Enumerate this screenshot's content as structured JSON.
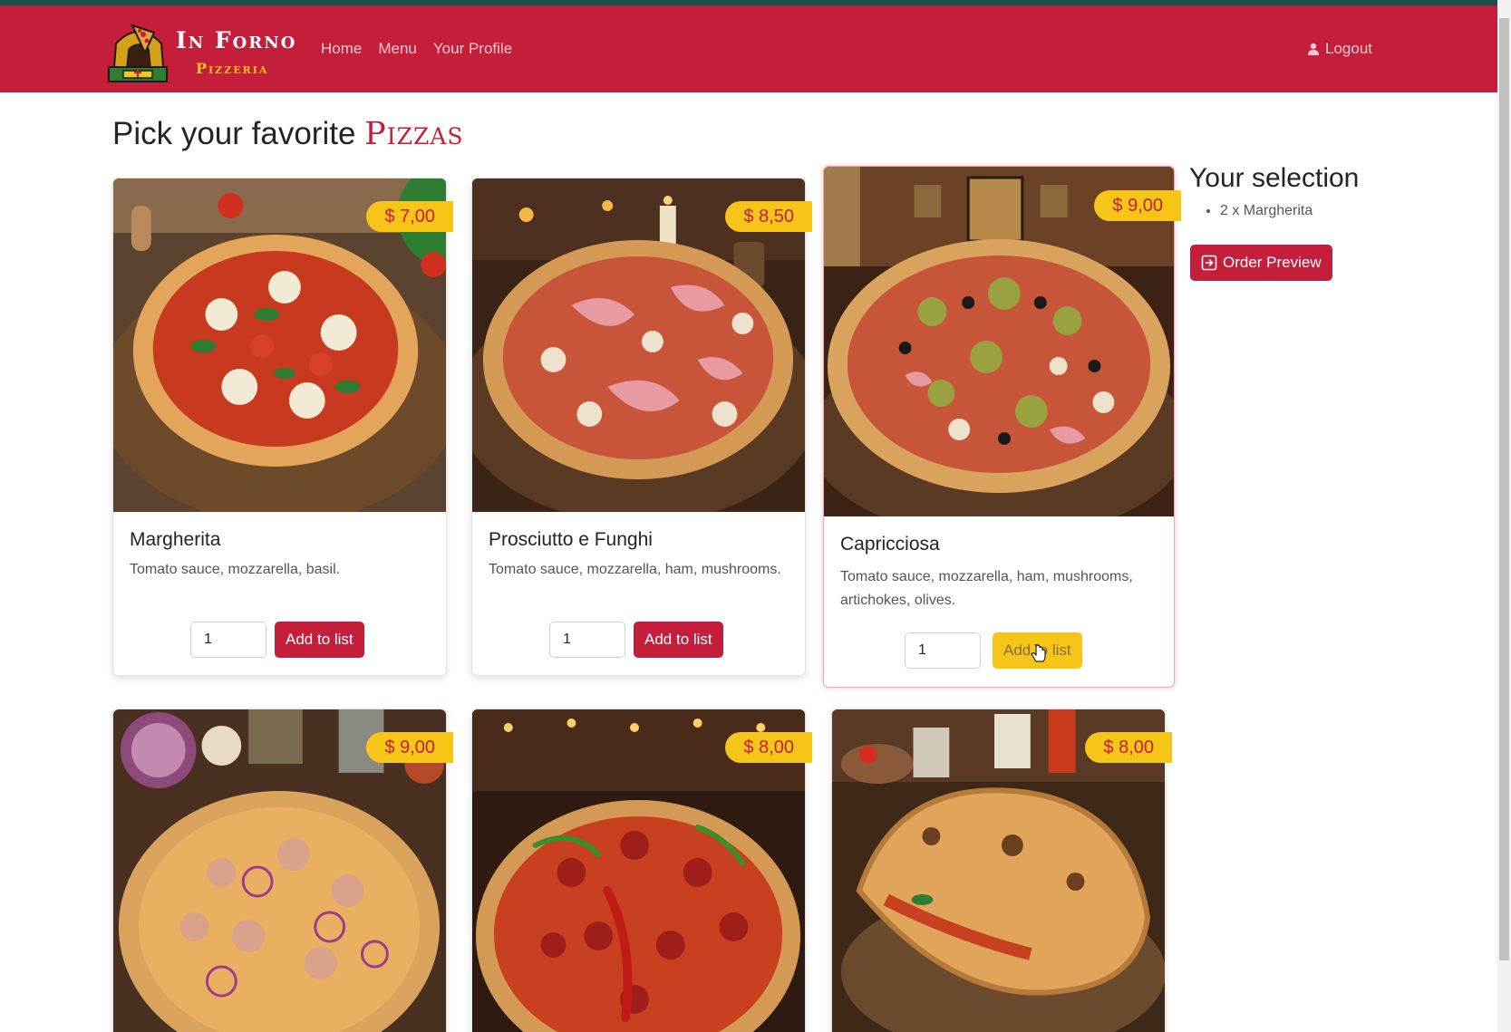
{
  "nav": {
    "brand_name": "In Forno",
    "brand_sub": "Pizzeria",
    "links": [
      "Home",
      "Menu",
      "Your Profile"
    ],
    "logout": "Logout"
  },
  "page": {
    "title_prefix": "Pick your favorite",
    "title_accent": "Pizzas"
  },
  "pizzas": [
    {
      "name": "Margherita",
      "price": "$ 7,00",
      "description": "Tomato sauce, mozzarella, basil.",
      "qty": "1",
      "button": "Add to list"
    },
    {
      "name": "Prosciutto e Funghi",
      "price": "$ 8,50",
      "description": "Tomato sauce, mozzarella, ham, mushrooms.",
      "qty": "1",
      "button": "Add to list"
    },
    {
      "name": "Capricciosa",
      "price": "$ 9,00",
      "description": "Tomato sauce, mozzarella, ham, mushrooms, artichokes, olives.",
      "qty": "1",
      "button": "Add to list"
    },
    {
      "price": "$ 9,00"
    },
    {
      "price": "$ 8,00"
    },
    {
      "price": "$ 8,00"
    }
  ],
  "selection": {
    "title": "Your selection",
    "items": [
      "2 x Margherita"
    ],
    "order_button": "Order Preview"
  },
  "colors": {
    "brand_red": "#c41e3a",
    "accent_yellow": "#f5c518",
    "top_line": "#1f4f46"
  },
  "icons": {
    "logout": "user-icon",
    "order_preview": "box-arrow-in-icon"
  }
}
